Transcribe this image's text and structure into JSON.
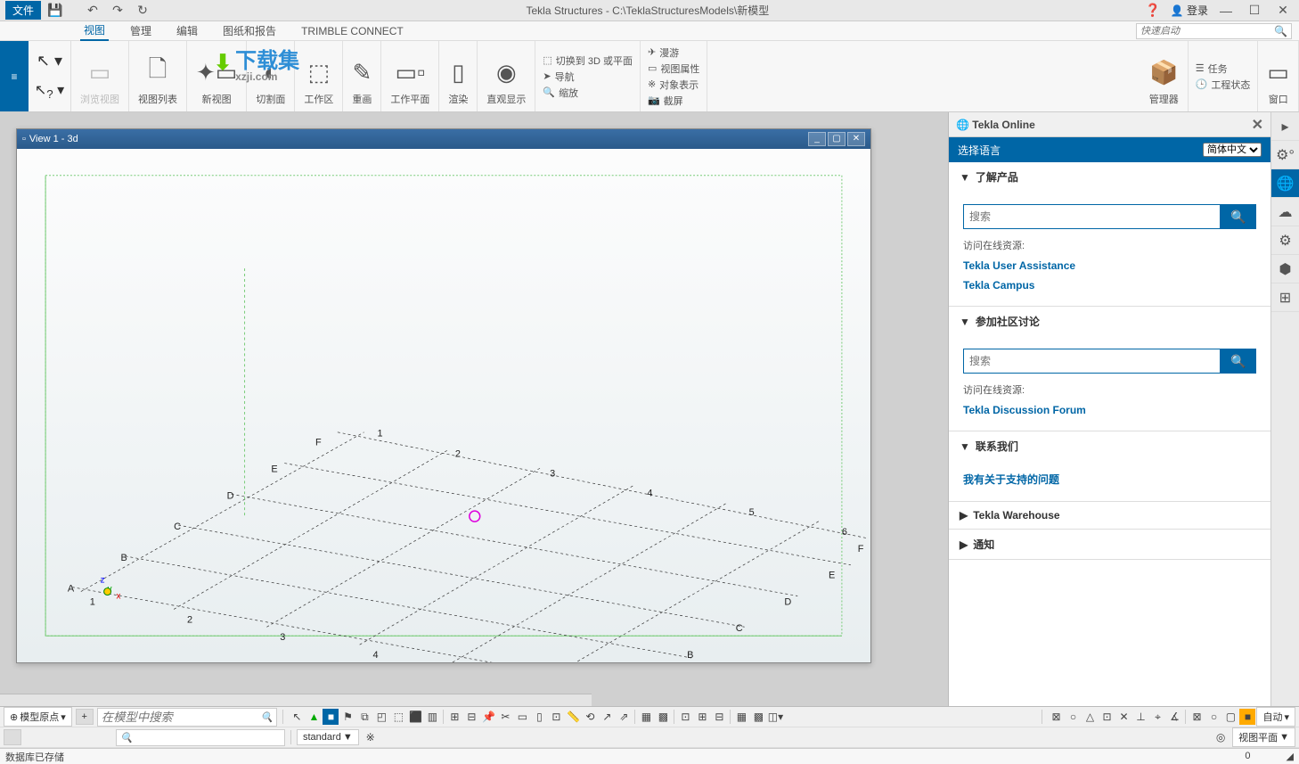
{
  "titlebar": {
    "file": "文件",
    "title": "Tekla Structures - C:\\TeklaStructuresModels\\新模型",
    "login": "登录"
  },
  "menu": {
    "tabs": [
      "视图",
      "管理",
      "编辑",
      "图纸和报告",
      "TRIMBLE CONNECT"
    ],
    "active": 0,
    "quicklaunch_placeholder": "快速启动"
  },
  "ribbon": {
    "groups": [
      {
        "label": "浏览视图",
        "disabled": true
      },
      {
        "label": "视图列表"
      },
      {
        "label": "新视图"
      },
      {
        "label": "切割面"
      },
      {
        "label": "工作区"
      },
      {
        "label": "重画"
      },
      {
        "label": "工作平面"
      },
      {
        "label": "渲染"
      },
      {
        "label": "直观显示"
      }
    ],
    "col1": [
      "切换到 3D 或平面",
      "导航",
      "缩放"
    ],
    "col2": [
      "漫游",
      "视图属性",
      "对象表示",
      "截屏"
    ],
    "manager": "管理器",
    "col3": [
      "任务",
      "工程状态"
    ],
    "window": "窗口"
  },
  "view": {
    "title": "View 1 - 3d",
    "letters": [
      "A",
      "B",
      "C",
      "D",
      "E",
      "F"
    ],
    "numbers": [
      "1",
      "2",
      "3",
      "4",
      "5",
      "6"
    ]
  },
  "sidepanel": {
    "title": "Tekla Online",
    "lang_label": "选择语言",
    "lang_value": "简体中文",
    "sections": {
      "learn": {
        "title": "了解产品",
        "search_ph": "搜索",
        "resources_label": "访问在线资源:",
        "links": [
          "Tekla User Assistance",
          "Tekla Campus"
        ]
      },
      "community": {
        "title": "参加社区讨论",
        "search_ph": "搜索",
        "resources_label": "访问在线资源:",
        "links": [
          "Tekla Discussion Forum"
        ]
      },
      "contact": {
        "title": "联系我们",
        "link": "我有关于支持的问题"
      },
      "warehouse": {
        "title": "Tekla Warehouse"
      },
      "notify": {
        "title": "通知"
      }
    }
  },
  "bottom": {
    "origin": "模型原点",
    "search_ph": "在模型中搜索",
    "standard": "standard",
    "viewplane": "视图平面",
    "auto": "自动"
  },
  "status": {
    "msg": "数据库已存储",
    "val": "0"
  },
  "watermark": {
    "text": "下载集",
    "sub": "xzji.com"
  }
}
